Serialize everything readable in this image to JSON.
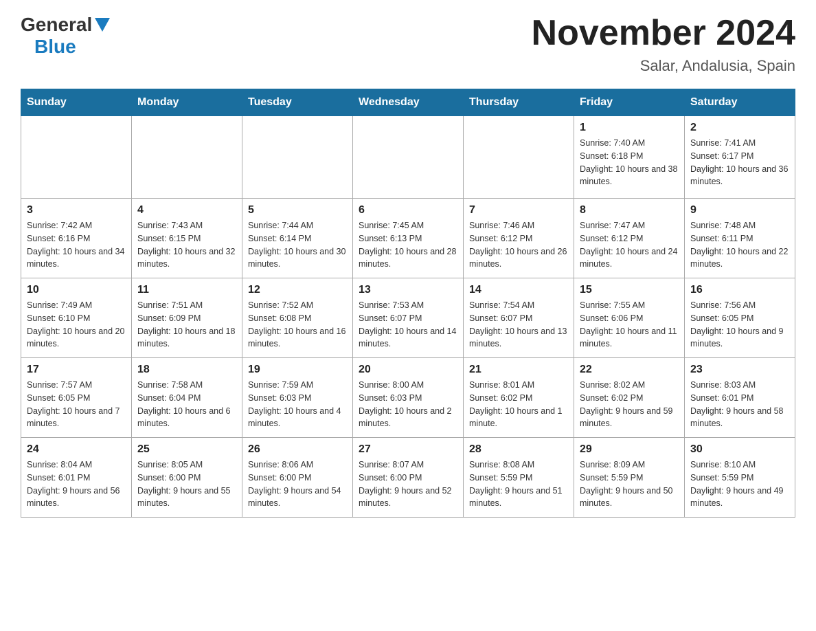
{
  "header": {
    "logo_general": "General",
    "logo_blue": "Blue",
    "month_title": "November 2024",
    "location": "Salar, Andalusia, Spain"
  },
  "weekdays": [
    "Sunday",
    "Monday",
    "Tuesday",
    "Wednesday",
    "Thursday",
    "Friday",
    "Saturday"
  ],
  "weeks": [
    [
      {
        "day": "",
        "info": ""
      },
      {
        "day": "",
        "info": ""
      },
      {
        "day": "",
        "info": ""
      },
      {
        "day": "",
        "info": ""
      },
      {
        "day": "",
        "info": ""
      },
      {
        "day": "1",
        "info": "Sunrise: 7:40 AM\nSunset: 6:18 PM\nDaylight: 10 hours and 38 minutes."
      },
      {
        "day": "2",
        "info": "Sunrise: 7:41 AM\nSunset: 6:17 PM\nDaylight: 10 hours and 36 minutes."
      }
    ],
    [
      {
        "day": "3",
        "info": "Sunrise: 7:42 AM\nSunset: 6:16 PM\nDaylight: 10 hours and 34 minutes."
      },
      {
        "day": "4",
        "info": "Sunrise: 7:43 AM\nSunset: 6:15 PM\nDaylight: 10 hours and 32 minutes."
      },
      {
        "day": "5",
        "info": "Sunrise: 7:44 AM\nSunset: 6:14 PM\nDaylight: 10 hours and 30 minutes."
      },
      {
        "day": "6",
        "info": "Sunrise: 7:45 AM\nSunset: 6:13 PM\nDaylight: 10 hours and 28 minutes."
      },
      {
        "day": "7",
        "info": "Sunrise: 7:46 AM\nSunset: 6:12 PM\nDaylight: 10 hours and 26 minutes."
      },
      {
        "day": "8",
        "info": "Sunrise: 7:47 AM\nSunset: 6:12 PM\nDaylight: 10 hours and 24 minutes."
      },
      {
        "day": "9",
        "info": "Sunrise: 7:48 AM\nSunset: 6:11 PM\nDaylight: 10 hours and 22 minutes."
      }
    ],
    [
      {
        "day": "10",
        "info": "Sunrise: 7:49 AM\nSunset: 6:10 PM\nDaylight: 10 hours and 20 minutes."
      },
      {
        "day": "11",
        "info": "Sunrise: 7:51 AM\nSunset: 6:09 PM\nDaylight: 10 hours and 18 minutes."
      },
      {
        "day": "12",
        "info": "Sunrise: 7:52 AM\nSunset: 6:08 PM\nDaylight: 10 hours and 16 minutes."
      },
      {
        "day": "13",
        "info": "Sunrise: 7:53 AM\nSunset: 6:07 PM\nDaylight: 10 hours and 14 minutes."
      },
      {
        "day": "14",
        "info": "Sunrise: 7:54 AM\nSunset: 6:07 PM\nDaylight: 10 hours and 13 minutes."
      },
      {
        "day": "15",
        "info": "Sunrise: 7:55 AM\nSunset: 6:06 PM\nDaylight: 10 hours and 11 minutes."
      },
      {
        "day": "16",
        "info": "Sunrise: 7:56 AM\nSunset: 6:05 PM\nDaylight: 10 hours and 9 minutes."
      }
    ],
    [
      {
        "day": "17",
        "info": "Sunrise: 7:57 AM\nSunset: 6:05 PM\nDaylight: 10 hours and 7 minutes."
      },
      {
        "day": "18",
        "info": "Sunrise: 7:58 AM\nSunset: 6:04 PM\nDaylight: 10 hours and 6 minutes."
      },
      {
        "day": "19",
        "info": "Sunrise: 7:59 AM\nSunset: 6:03 PM\nDaylight: 10 hours and 4 minutes."
      },
      {
        "day": "20",
        "info": "Sunrise: 8:00 AM\nSunset: 6:03 PM\nDaylight: 10 hours and 2 minutes."
      },
      {
        "day": "21",
        "info": "Sunrise: 8:01 AM\nSunset: 6:02 PM\nDaylight: 10 hours and 1 minute."
      },
      {
        "day": "22",
        "info": "Sunrise: 8:02 AM\nSunset: 6:02 PM\nDaylight: 9 hours and 59 minutes."
      },
      {
        "day": "23",
        "info": "Sunrise: 8:03 AM\nSunset: 6:01 PM\nDaylight: 9 hours and 58 minutes."
      }
    ],
    [
      {
        "day": "24",
        "info": "Sunrise: 8:04 AM\nSunset: 6:01 PM\nDaylight: 9 hours and 56 minutes."
      },
      {
        "day": "25",
        "info": "Sunrise: 8:05 AM\nSunset: 6:00 PM\nDaylight: 9 hours and 55 minutes."
      },
      {
        "day": "26",
        "info": "Sunrise: 8:06 AM\nSunset: 6:00 PM\nDaylight: 9 hours and 54 minutes."
      },
      {
        "day": "27",
        "info": "Sunrise: 8:07 AM\nSunset: 6:00 PM\nDaylight: 9 hours and 52 minutes."
      },
      {
        "day": "28",
        "info": "Sunrise: 8:08 AM\nSunset: 5:59 PM\nDaylight: 9 hours and 51 minutes."
      },
      {
        "day": "29",
        "info": "Sunrise: 8:09 AM\nSunset: 5:59 PM\nDaylight: 9 hours and 50 minutes."
      },
      {
        "day": "30",
        "info": "Sunrise: 8:10 AM\nSunset: 5:59 PM\nDaylight: 9 hours and 49 minutes."
      }
    ]
  ]
}
